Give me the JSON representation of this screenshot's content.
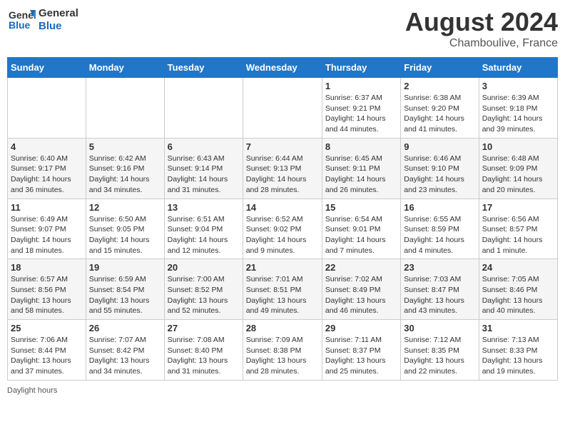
{
  "header": {
    "logo_line1": "General",
    "logo_line2": "Blue",
    "month_year": "August 2024",
    "location": "Chamboulive, France"
  },
  "days_of_week": [
    "Sunday",
    "Monday",
    "Tuesday",
    "Wednesday",
    "Thursday",
    "Friday",
    "Saturday"
  ],
  "footer_label": "Daylight hours",
  "weeks": [
    [
      {
        "day": "",
        "info": ""
      },
      {
        "day": "",
        "info": ""
      },
      {
        "day": "",
        "info": ""
      },
      {
        "day": "",
        "info": ""
      },
      {
        "day": "1",
        "info": "Sunrise: 6:37 AM\nSunset: 9:21 PM\nDaylight: 14 hours and 44 minutes."
      },
      {
        "day": "2",
        "info": "Sunrise: 6:38 AM\nSunset: 9:20 PM\nDaylight: 14 hours and 41 minutes."
      },
      {
        "day": "3",
        "info": "Sunrise: 6:39 AM\nSunset: 9:18 PM\nDaylight: 14 hours and 39 minutes."
      }
    ],
    [
      {
        "day": "4",
        "info": "Sunrise: 6:40 AM\nSunset: 9:17 PM\nDaylight: 14 hours and 36 minutes."
      },
      {
        "day": "5",
        "info": "Sunrise: 6:42 AM\nSunset: 9:16 PM\nDaylight: 14 hours and 34 minutes."
      },
      {
        "day": "6",
        "info": "Sunrise: 6:43 AM\nSunset: 9:14 PM\nDaylight: 14 hours and 31 minutes."
      },
      {
        "day": "7",
        "info": "Sunrise: 6:44 AM\nSunset: 9:13 PM\nDaylight: 14 hours and 28 minutes."
      },
      {
        "day": "8",
        "info": "Sunrise: 6:45 AM\nSunset: 9:11 PM\nDaylight: 14 hours and 26 minutes."
      },
      {
        "day": "9",
        "info": "Sunrise: 6:46 AM\nSunset: 9:10 PM\nDaylight: 14 hours and 23 minutes."
      },
      {
        "day": "10",
        "info": "Sunrise: 6:48 AM\nSunset: 9:09 PM\nDaylight: 14 hours and 20 minutes."
      }
    ],
    [
      {
        "day": "11",
        "info": "Sunrise: 6:49 AM\nSunset: 9:07 PM\nDaylight: 14 hours and 18 minutes."
      },
      {
        "day": "12",
        "info": "Sunrise: 6:50 AM\nSunset: 9:05 PM\nDaylight: 14 hours and 15 minutes."
      },
      {
        "day": "13",
        "info": "Sunrise: 6:51 AM\nSunset: 9:04 PM\nDaylight: 14 hours and 12 minutes."
      },
      {
        "day": "14",
        "info": "Sunrise: 6:52 AM\nSunset: 9:02 PM\nDaylight: 14 hours and 9 minutes."
      },
      {
        "day": "15",
        "info": "Sunrise: 6:54 AM\nSunset: 9:01 PM\nDaylight: 14 hours and 7 minutes."
      },
      {
        "day": "16",
        "info": "Sunrise: 6:55 AM\nSunset: 8:59 PM\nDaylight: 14 hours and 4 minutes."
      },
      {
        "day": "17",
        "info": "Sunrise: 6:56 AM\nSunset: 8:57 PM\nDaylight: 14 hours and 1 minute."
      }
    ],
    [
      {
        "day": "18",
        "info": "Sunrise: 6:57 AM\nSunset: 8:56 PM\nDaylight: 13 hours and 58 minutes."
      },
      {
        "day": "19",
        "info": "Sunrise: 6:59 AM\nSunset: 8:54 PM\nDaylight: 13 hours and 55 minutes."
      },
      {
        "day": "20",
        "info": "Sunrise: 7:00 AM\nSunset: 8:52 PM\nDaylight: 13 hours and 52 minutes."
      },
      {
        "day": "21",
        "info": "Sunrise: 7:01 AM\nSunset: 8:51 PM\nDaylight: 13 hours and 49 minutes."
      },
      {
        "day": "22",
        "info": "Sunrise: 7:02 AM\nSunset: 8:49 PM\nDaylight: 13 hours and 46 minutes."
      },
      {
        "day": "23",
        "info": "Sunrise: 7:03 AM\nSunset: 8:47 PM\nDaylight: 13 hours and 43 minutes."
      },
      {
        "day": "24",
        "info": "Sunrise: 7:05 AM\nSunset: 8:46 PM\nDaylight: 13 hours and 40 minutes."
      }
    ],
    [
      {
        "day": "25",
        "info": "Sunrise: 7:06 AM\nSunset: 8:44 PM\nDaylight: 13 hours and 37 minutes."
      },
      {
        "day": "26",
        "info": "Sunrise: 7:07 AM\nSunset: 8:42 PM\nDaylight: 13 hours and 34 minutes."
      },
      {
        "day": "27",
        "info": "Sunrise: 7:08 AM\nSunset: 8:40 PM\nDaylight: 13 hours and 31 minutes."
      },
      {
        "day": "28",
        "info": "Sunrise: 7:09 AM\nSunset: 8:38 PM\nDaylight: 13 hours and 28 minutes."
      },
      {
        "day": "29",
        "info": "Sunrise: 7:11 AM\nSunset: 8:37 PM\nDaylight: 13 hours and 25 minutes."
      },
      {
        "day": "30",
        "info": "Sunrise: 7:12 AM\nSunset: 8:35 PM\nDaylight: 13 hours and 22 minutes."
      },
      {
        "day": "31",
        "info": "Sunrise: 7:13 AM\nSunset: 8:33 PM\nDaylight: 13 hours and 19 minutes."
      }
    ]
  ]
}
